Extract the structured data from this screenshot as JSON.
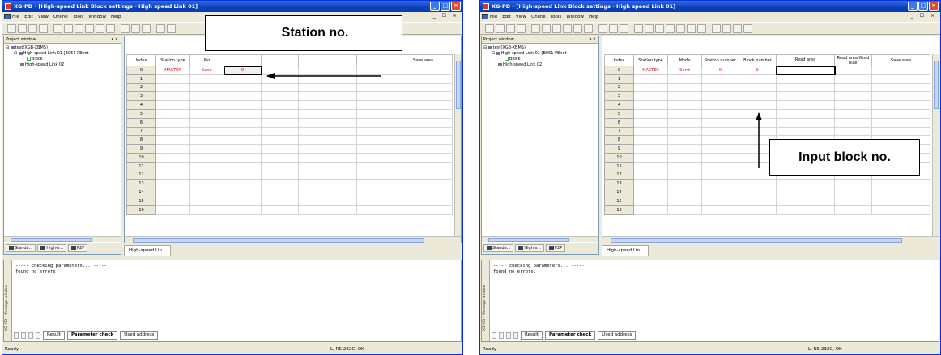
{
  "window_left": {
    "title": "XG-PD - [High-speed Link Block settings - High speed Link 01]",
    "menu": [
      "File",
      "Edit",
      "View",
      "Online",
      "Tools",
      "Window",
      "Help"
    ],
    "project_window_title": "Project window",
    "tree": [
      "test(XGB-XBMS)",
      "High-speed Link 01 [B051 PEnet",
      "Block",
      "High-speed Link 02"
    ],
    "panel_tabs": [
      "Standa...",
      "High-s...",
      "P2P"
    ],
    "columns": [
      "Index",
      "Station type",
      "Mo",
      "",
      "",
      "",
      "",
      "Save area"
    ],
    "row0": {
      "station_type": "MASTER",
      "mode": "Send",
      "station_number": "0"
    },
    "doc_tab": "High-speed Lin..."
  },
  "window_right": {
    "title": "XG-PD - [High-speed Link Block settings - High speed Link 01]",
    "menu": [
      "File",
      "Edit",
      "View",
      "Online",
      "Tools",
      "Window",
      "Help"
    ],
    "project_window_title": "Project window",
    "tree": [
      "test(XGB-XBMS)",
      "High-speed Link 01 [B051 PEnet",
      "Block",
      "High-speed Link 02"
    ],
    "panel_tabs": [
      "Standa...",
      "High-s...",
      "P2P"
    ],
    "columns": [
      "Index",
      "Station type",
      "Mode",
      "Station number",
      "Block number",
      "Read area",
      "Read area Word size",
      "Save area"
    ],
    "row0": {
      "station_type": "MASTER",
      "mode": "Send",
      "station_number": "0",
      "block_number": "0"
    },
    "doc_tab": "High-speed Lin..."
  },
  "row_indices": [
    "0",
    "1",
    "2",
    "3",
    "4",
    "5",
    "6",
    "7",
    "8",
    "9",
    "10",
    "11",
    "12",
    "13",
    "14",
    "15",
    "16"
  ],
  "message": {
    "side_label": "XG-PD - Message window",
    "text": "----- checking parameters... -----\nfound no errors.",
    "tabs": [
      "Result",
      "Parameter check",
      "Used address"
    ]
  },
  "status": {
    "left": "Ready",
    "connection": "L, RS-232C, OK"
  },
  "callouts": {
    "station": "Station no.",
    "block": "Input block no."
  },
  "colors": {
    "title_bar": "#0a3fbf",
    "value_red": "#d01010",
    "panel_bg": "#ece9d8"
  }
}
